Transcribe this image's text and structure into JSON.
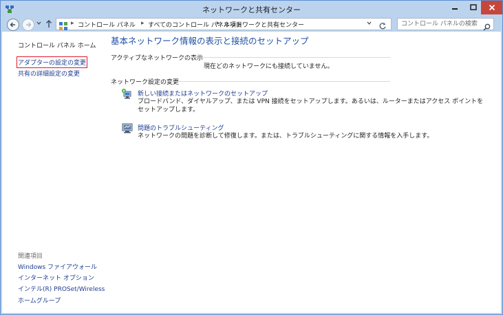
{
  "window": {
    "title": "ネットワークと共有センター",
    "app_icon": "network-center-icon",
    "minimize_icon": "minimize-icon",
    "maximize_icon": "maximize-icon",
    "close_icon": "close-icon"
  },
  "nav": {
    "back_icon": "back-arrow-icon",
    "forward_icon": "forward-arrow-icon",
    "history_icon": "chevron-down-icon",
    "up_icon": "up-arrow-icon",
    "refresh_icon": "refresh-icon",
    "breadcrumb": [
      "コントロール パネル",
      "すべてのコントロール パネル項目",
      "ネットワークと共有センター"
    ],
    "search_placeholder": "コントロール パネルの検索"
  },
  "sidebar": {
    "home": "コントロール パネル ホーム",
    "items": [
      "アダプターの設定の変更",
      "共有の詳細設定の変更"
    ],
    "related_heading": "関連項目",
    "related": [
      "Windows ファイアウォール",
      "インターネット オプション",
      "インテル(R) PROSet/Wireless",
      "ホームグループ"
    ]
  },
  "main": {
    "title": "基本ネットワーク情報の表示と接続のセットアップ",
    "active_section": {
      "heading": "アクティブなネットワークの表示",
      "status": "現在どのネットワークにも接続していません。"
    },
    "change_section": {
      "heading": "ネットワーク設定の変更",
      "tasks": [
        {
          "icon": "new-connection-icon",
          "link": "新しい接続またはネットワークのセットアップ",
          "desc_line1": "ブロードバンド、ダイヤルアップ、または VPN 接続をセットアップします。あるいは、ルーターまたはアクセス ポイントを",
          "desc_line2": "セットアップします。"
        },
        {
          "icon": "troubleshoot-icon",
          "link": "問題のトラブルシューティング",
          "desc_line1": "ネットワークの問題を診断して修復します。または、トラブルシューティングに関する情報を入手します。"
        }
      ]
    }
  },
  "colors": {
    "frame": "#bcd3ee",
    "link": "#1e3d8f",
    "title": "#1f4fa6",
    "close_button": "#c7463c",
    "highlight": "#e0162b"
  }
}
